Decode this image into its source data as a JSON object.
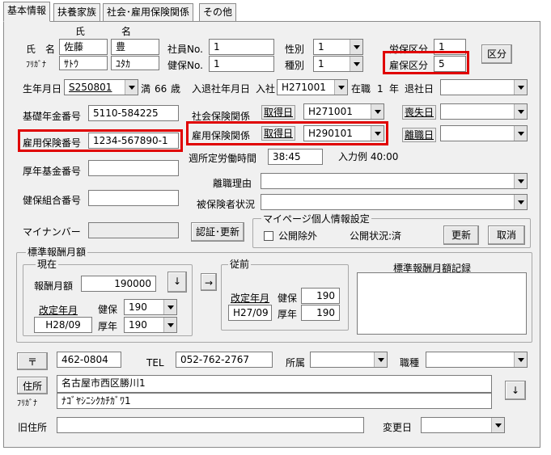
{
  "tabs": [
    "基本情報",
    "扶養家族",
    "社会･雇用保険関係",
    "その他"
  ],
  "name": {
    "label": "氏　名",
    "kana_label": "ﾌﾘｶﾞﾅ",
    "col_sei": "氏",
    "col_mei": "名",
    "sei": "佐藤",
    "mei": "豊",
    "sei_kana": "ｻﾄｳ",
    "mei_kana": "ﾕﾀｶ"
  },
  "shain_no": {
    "label": "社員No.",
    "value": "1"
  },
  "kenpo_no": {
    "label": "健保No.",
    "value": "1"
  },
  "seibetsu": {
    "label": "性別",
    "value": "1"
  },
  "shubetsu": {
    "label": "種別",
    "value": "1"
  },
  "rouho_kubun": {
    "label": "労保区分",
    "value": "1"
  },
  "koho_kubun": {
    "label": "雇保区分",
    "value": "5"
  },
  "kubun_button": "区分",
  "birth": {
    "label": "生年月日",
    "value": "S250801",
    "age_prefix": "満",
    "age": "66",
    "age_suffix": "歳"
  },
  "nyutai": {
    "label": "入退社年月日",
    "nyusha_label": "入社",
    "nyusha": "H271001",
    "zaishoku_label": "在職",
    "zaishoku_years": "1",
    "zaishoku_unit": "年",
    "taisha_label": "退社日",
    "taisha": ""
  },
  "kiso_nenkin": {
    "label": "基礎年金番号",
    "value": "5110-584225"
  },
  "koyo_hoken_no": {
    "label": "雇用保険番号",
    "value": "1234-567890-1"
  },
  "kosei_kikin": {
    "label": "厚年基金番号",
    "value": ""
  },
  "kenpo_kumiai": {
    "label": "健保組合番号",
    "value": ""
  },
  "mynumber": {
    "label": "マイナンバー",
    "value": ""
  },
  "shakai_hoken": {
    "label": "社会保険関係",
    "shutoku_label": "取得日",
    "shutoku": "H271001",
    "soshitsu_label": "喪失日",
    "soshitsu": ""
  },
  "koyo_hoken": {
    "label": "雇用保険関係",
    "shutoku_label": "取得日",
    "shutoku": "H290101",
    "rishoku_label": "離職日",
    "rishoku": ""
  },
  "shotei_rodo": {
    "label": "週所定労働時間",
    "value": "38:45",
    "example": "入力例 40:00"
  },
  "rishoku_riyu": {
    "label": "離職理由",
    "value": ""
  },
  "hihokensha": {
    "label": "被保険者状況",
    "value": ""
  },
  "ninsho_button": "認証･更新",
  "mypage": {
    "title": "マイページ個人情報設定",
    "koukai_jogai": "公開除外",
    "koukai_status": "公開状況:済",
    "koshin_button": "更新",
    "torikeshi_button": "取消"
  },
  "hyojun": {
    "title": "標準報酬月額",
    "genzai_title": "現在",
    "hoshu_label": "報酬月額",
    "hoshu": "190000",
    "down_button": "↓",
    "kaitei_label": "改定年月",
    "kaitei": "H28/09",
    "kenpo_label": "健保",
    "kenpo": "190",
    "kounen_label": "厚年",
    "kounen": "190",
    "arrow_button": "→",
    "juzen_title": "従前",
    "juzen_kaitei_label": "改定年月",
    "juzen_kaitei": "H27/09",
    "juzen_kenpo_label": "健保",
    "juzen_kenpo": "190",
    "juzen_kounen_label": "厚年",
    "juzen_kounen": "190",
    "kiroku_title": "標準報酬月額記録"
  },
  "address": {
    "yubin_button": "〒",
    "yubin": "462-0804",
    "tel_label": "TEL",
    "tel": "052-762-2767",
    "shozoku_label": "所属",
    "shozoku": "",
    "shokushu_label": "職種",
    "shokushu": "",
    "jusho_button": "住所",
    "kana_label": "ﾌﾘｶﾞﾅ",
    "jusho": "名古屋市西区勝川1",
    "jusho_kana": "ﾅｺﾞﾔｼﾆｼｸｶﾁｶﾞﾜ1",
    "down_button": "↓",
    "kyu_jusho_label": "旧住所",
    "kyu_jusho": "",
    "henko_label": "変更日",
    "henko": ""
  }
}
